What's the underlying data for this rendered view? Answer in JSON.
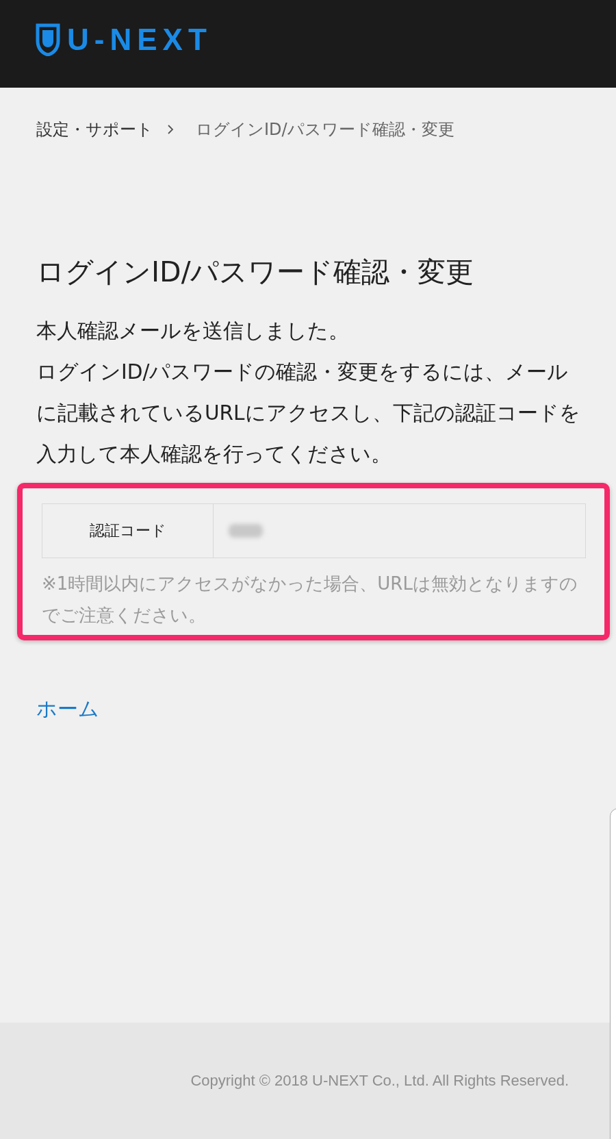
{
  "header": {
    "logo_text": "U-NEXT"
  },
  "breadcrumb": [
    {
      "label": "設定・サポート",
      "kind": "link"
    },
    {
      "label": "ログインID/パスワード確認・変更",
      "kind": "current"
    }
  ],
  "title": "ログインID/パスワード確認・変更",
  "message": [
    "本人確認メールを送信しました。",
    "ログインID/パスワードの確認・変更をするには、メールに記載されているURLにアクセスし、下記の認証コードを入力して本人確認を行ってください。"
  ],
  "code_table": {
    "label": "認証コード",
    "value": {
      "kind": "blurred"
    },
    "highlighted": true
  },
  "note": "※1時間以内にアクセスがなかった場合、URLは無効となりますのでご注意ください。",
  "home_link": "ホーム",
  "footer": {
    "copyright": "Copyright © 2018 U-NEXT Co., Ltd. All Rights Reserved."
  }
}
